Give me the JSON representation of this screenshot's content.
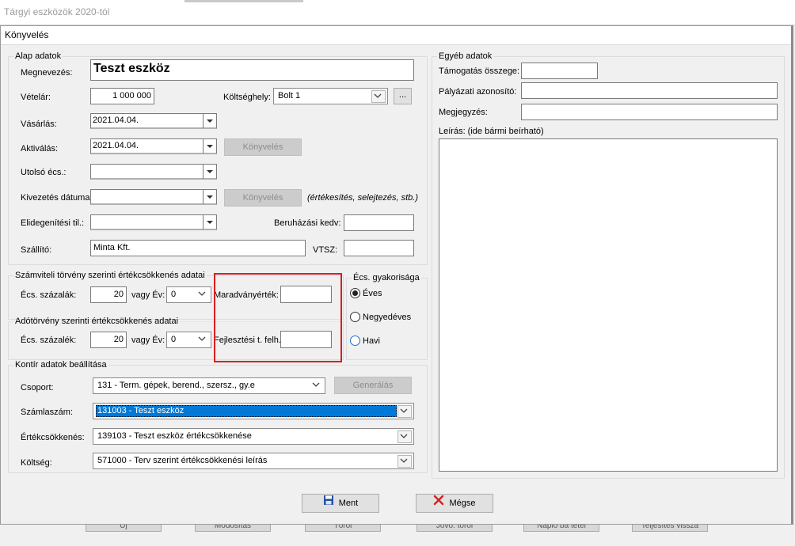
{
  "window_title": "Tárgyi eszközök 2020-tól",
  "dialog_title": "Könyvelés",
  "alap": {
    "legend": "Alap adatok",
    "megnevezes_label": "Megnevezés:",
    "megnevezes_value": "Teszt eszköz",
    "vetelar_label": "Vételár:",
    "vetelar_value": "1 000 000",
    "koltseghely_label": "Költséghely:",
    "koltseghely_value": "Bolt 1",
    "koltseghely_browse": "...",
    "vasarlas_label": "Vásárlás:",
    "vasarlas_value": "2021.04.04.",
    "aktivalas_label": "Aktiválás:",
    "aktivalas_value": "2021.04.04.",
    "konyveles1_label": "Könyvelés",
    "utolso_label": "Utolsó écs.:",
    "utolso_value": "",
    "kivezetes_label": "Kivezetés dátuma:",
    "kivezetes_value": "",
    "konyveles2_label": "Könyvelés",
    "kivezetes_note": "(értékesítés, selejtezés, stb.)",
    "elidegenitesi_label": "Elidegenítési til.:",
    "elidegenitesi_value": "",
    "beruhazasi_label": "Beruházási kedv:",
    "beruhazasi_value": "",
    "szallito_label": "Szállító:",
    "szallito_value": "Minta Kft.",
    "vtsz_label": "VTSZ:",
    "vtsz_value": ""
  },
  "szamviteli": {
    "legend": "Számviteli törvény szerinti értékcsökkenés adatai",
    "ecs_label": "Écs. százalák:",
    "ecs_value": "20",
    "vagy_ev_label": "vagy Év:",
    "ev_value": "0",
    "maradvany_label": "Maradványérték:",
    "maradvany_value": ""
  },
  "ado": {
    "legend": "Adótörvény szerinti értékcsökkenés adatai",
    "ecs_label": "Écs. százalék:",
    "ecs_value": "20",
    "vagy_ev_label": "vagy Év:",
    "ev_value": "0",
    "fejlesztesi_label": "Fejlesztési t. felh.:",
    "fejlesztesi_value": ""
  },
  "gyakorisag": {
    "legend": "Écs. gyakorisága",
    "options": [
      "Éves",
      "Negyedéves",
      "Havi"
    ],
    "selected": 0
  },
  "kontir": {
    "legend": "Kontír adatok beállítása",
    "csoport_label": "Csoport:",
    "csoport_value": "131 - Term. gépek, berend., szersz., gy.e",
    "generalas_label": "Generálás",
    "szamlaszam_label": "Számlaszám:",
    "szamlaszam_value": "131003 - Teszt eszköz",
    "ertekcsokkenes_label": "Értékcsökkenés:",
    "ertekcsokkenes_value": "139103 - Teszt eszköz értékcsökkenése",
    "koltseg_label": "Költség:",
    "koltseg_value": "571000 - Terv szerint értékcsökkenési leírás"
  },
  "egyeb": {
    "legend": "Egyéb adatok",
    "tamogatas_label": "Támogatás összege:",
    "tamogatas_value": "",
    "palyazati_label": "Pályázati azonosító:",
    "palyazati_value": "",
    "megjegyzes_label": "Megjegyzés:",
    "megjegyzes_value": "",
    "leiras_label": "Leírás: (ide bármi beírható)",
    "leiras_value": ""
  },
  "buttons": {
    "ment": "Ment",
    "megse": "Mégse"
  },
  "background_buttons": [
    "Új",
    "Módosítás",
    "Töröl",
    "Jövő. töröl",
    "Napló ba tétel",
    "Teljesítés vissza"
  ],
  "colors": {
    "highlight_bg": "#0078d7",
    "red_frame": "#d62020",
    "disabled_text": "#8d8d8d"
  }
}
